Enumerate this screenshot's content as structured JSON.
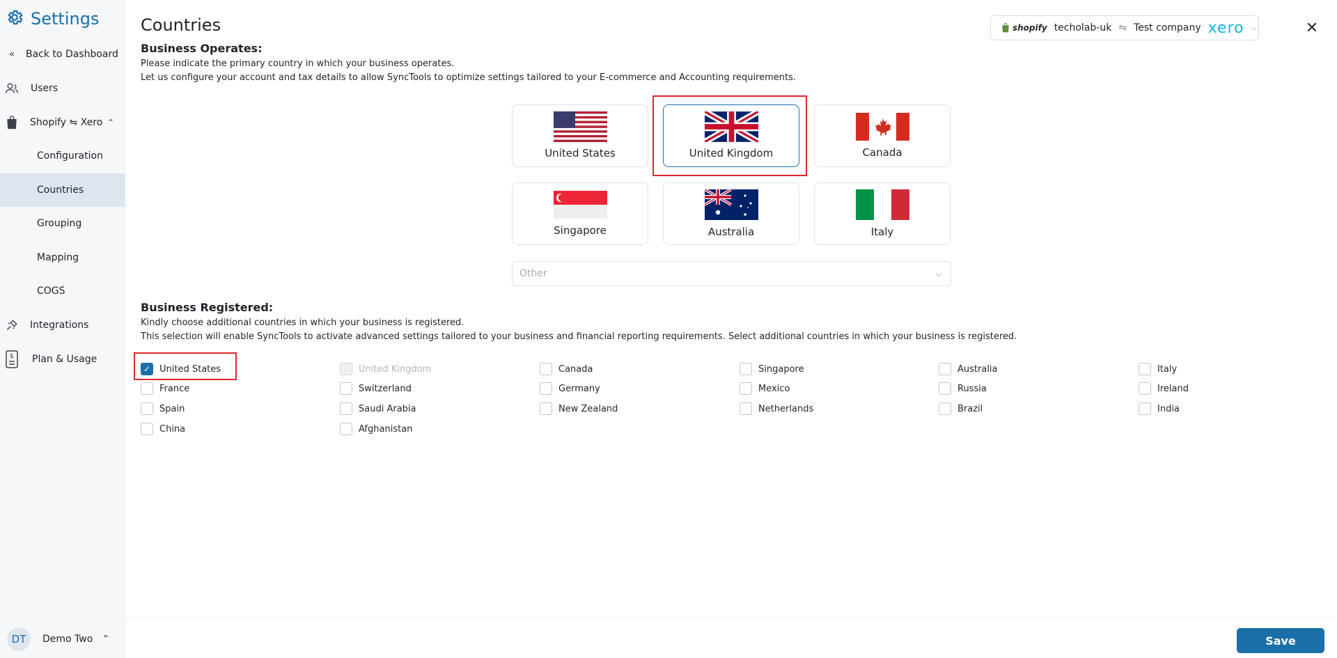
{
  "sidebar": {
    "brand_title": "Settings",
    "back_label": "Back to Dashboard",
    "users_label": "Users",
    "shopify_xero_label": "Shopify ⇋ Xero",
    "sub_items": [
      "Configuration",
      "Countries",
      "Grouping",
      "Mapping",
      "COGS"
    ],
    "active_sub": "Countries",
    "integrations_label": "Integrations",
    "plan_label": "Plan & Usage",
    "user": {
      "initials": "DT",
      "name": "Demo Two"
    }
  },
  "header": {
    "title": "Countries",
    "connector": {
      "shopify_label": "shopify",
      "store": "techolab-uk",
      "arrow": "⇋",
      "company": "Test company",
      "xero_label": "xero"
    }
  },
  "operates": {
    "title": "Business Operates:",
    "desc1": "Please indicate the primary country in which your business operates.",
    "desc2": "Let us configure your account and tax details to allow SyncTools to optimize settings tailored to your E-commerce and Accounting requirements.",
    "countries": [
      "United States",
      "United Kingdom",
      "Canada",
      "Singapore",
      "Australia",
      "Italy"
    ],
    "selected": "United Kingdom",
    "other_placeholder": "Other"
  },
  "registered": {
    "title": "Business Registered:",
    "desc1": "Kindly choose additional countries in which your business is registered.",
    "desc2": "This selection will enable SyncTools to activate advanced settings tailored to your business and financial reporting requirements. Select additional countries in which your business is registered.",
    "checkboxes": [
      {
        "label": "United States",
        "checked": true,
        "disabled": false
      },
      {
        "label": "United Kingdom",
        "checked": false,
        "disabled": true
      },
      {
        "label": "Canada",
        "checked": false,
        "disabled": false
      },
      {
        "label": "Singapore",
        "checked": false,
        "disabled": false
      },
      {
        "label": "Australia",
        "checked": false,
        "disabled": false
      },
      {
        "label": "Italy",
        "checked": false,
        "disabled": false
      },
      {
        "label": "France",
        "checked": false,
        "disabled": false
      },
      {
        "label": "Switzerland",
        "checked": false,
        "disabled": false
      },
      {
        "label": "Germany",
        "checked": false,
        "disabled": false
      },
      {
        "label": "Mexico",
        "checked": false,
        "disabled": false
      },
      {
        "label": "Russia",
        "checked": false,
        "disabled": false
      },
      {
        "label": "Ireland",
        "checked": false,
        "disabled": false
      },
      {
        "label": "Spain",
        "checked": false,
        "disabled": false
      },
      {
        "label": "Saudi Arabia",
        "checked": false,
        "disabled": false
      },
      {
        "label": "New Zealand",
        "checked": false,
        "disabled": false
      },
      {
        "label": "Netherlands",
        "checked": false,
        "disabled": false
      },
      {
        "label": "Brazil",
        "checked": false,
        "disabled": false
      },
      {
        "label": "India",
        "checked": false,
        "disabled": false
      },
      {
        "label": "China",
        "checked": false,
        "disabled": false
      },
      {
        "label": "Afghanistan",
        "checked": false,
        "disabled": false
      }
    ]
  },
  "footer": {
    "save_label": "Save"
  },
  "colors": {
    "accent": "#1a6fa8",
    "highlight": "#e0262c"
  }
}
